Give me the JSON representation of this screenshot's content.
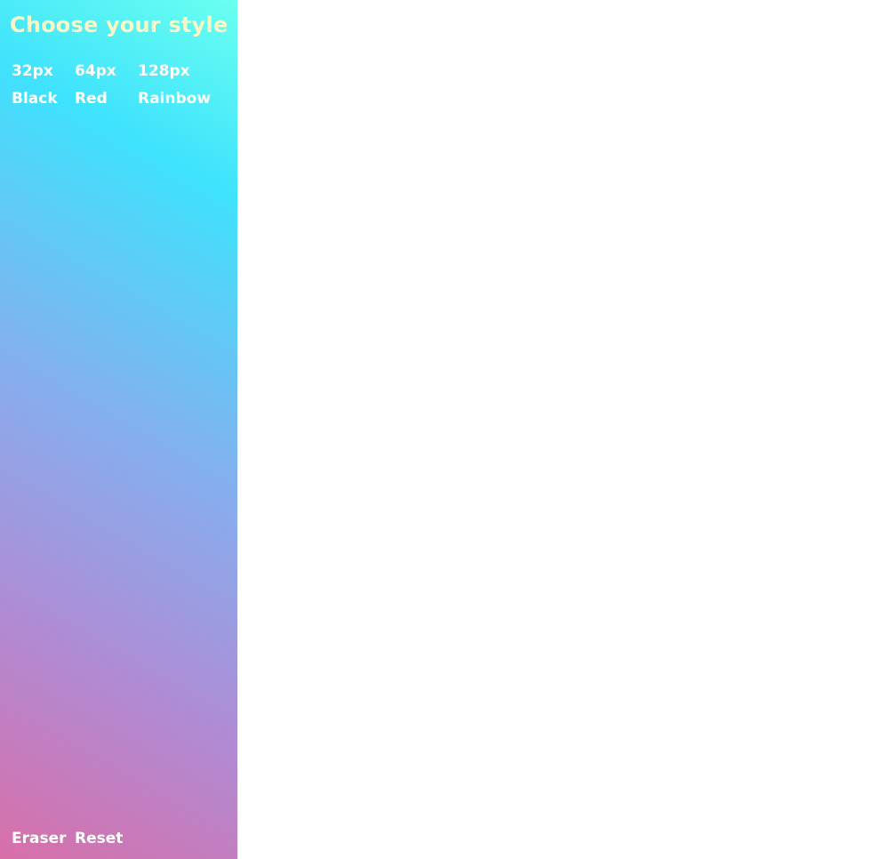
{
  "sidebar": {
    "title": "Choose your style",
    "sizes": [
      "32px",
      "64px",
      "128px"
    ],
    "colors": [
      "Black",
      "Red",
      "Rainbow"
    ],
    "actions": {
      "eraser": "Eraser",
      "reset": "Reset"
    },
    "gradient_colors": [
      "#d86fa8",
      "#b08bd4",
      "#86aeee",
      "#3fe2fd",
      "#6afff0"
    ],
    "title_color": "#fbf7c4"
  },
  "canvas": {
    "background": "#ffffff"
  }
}
